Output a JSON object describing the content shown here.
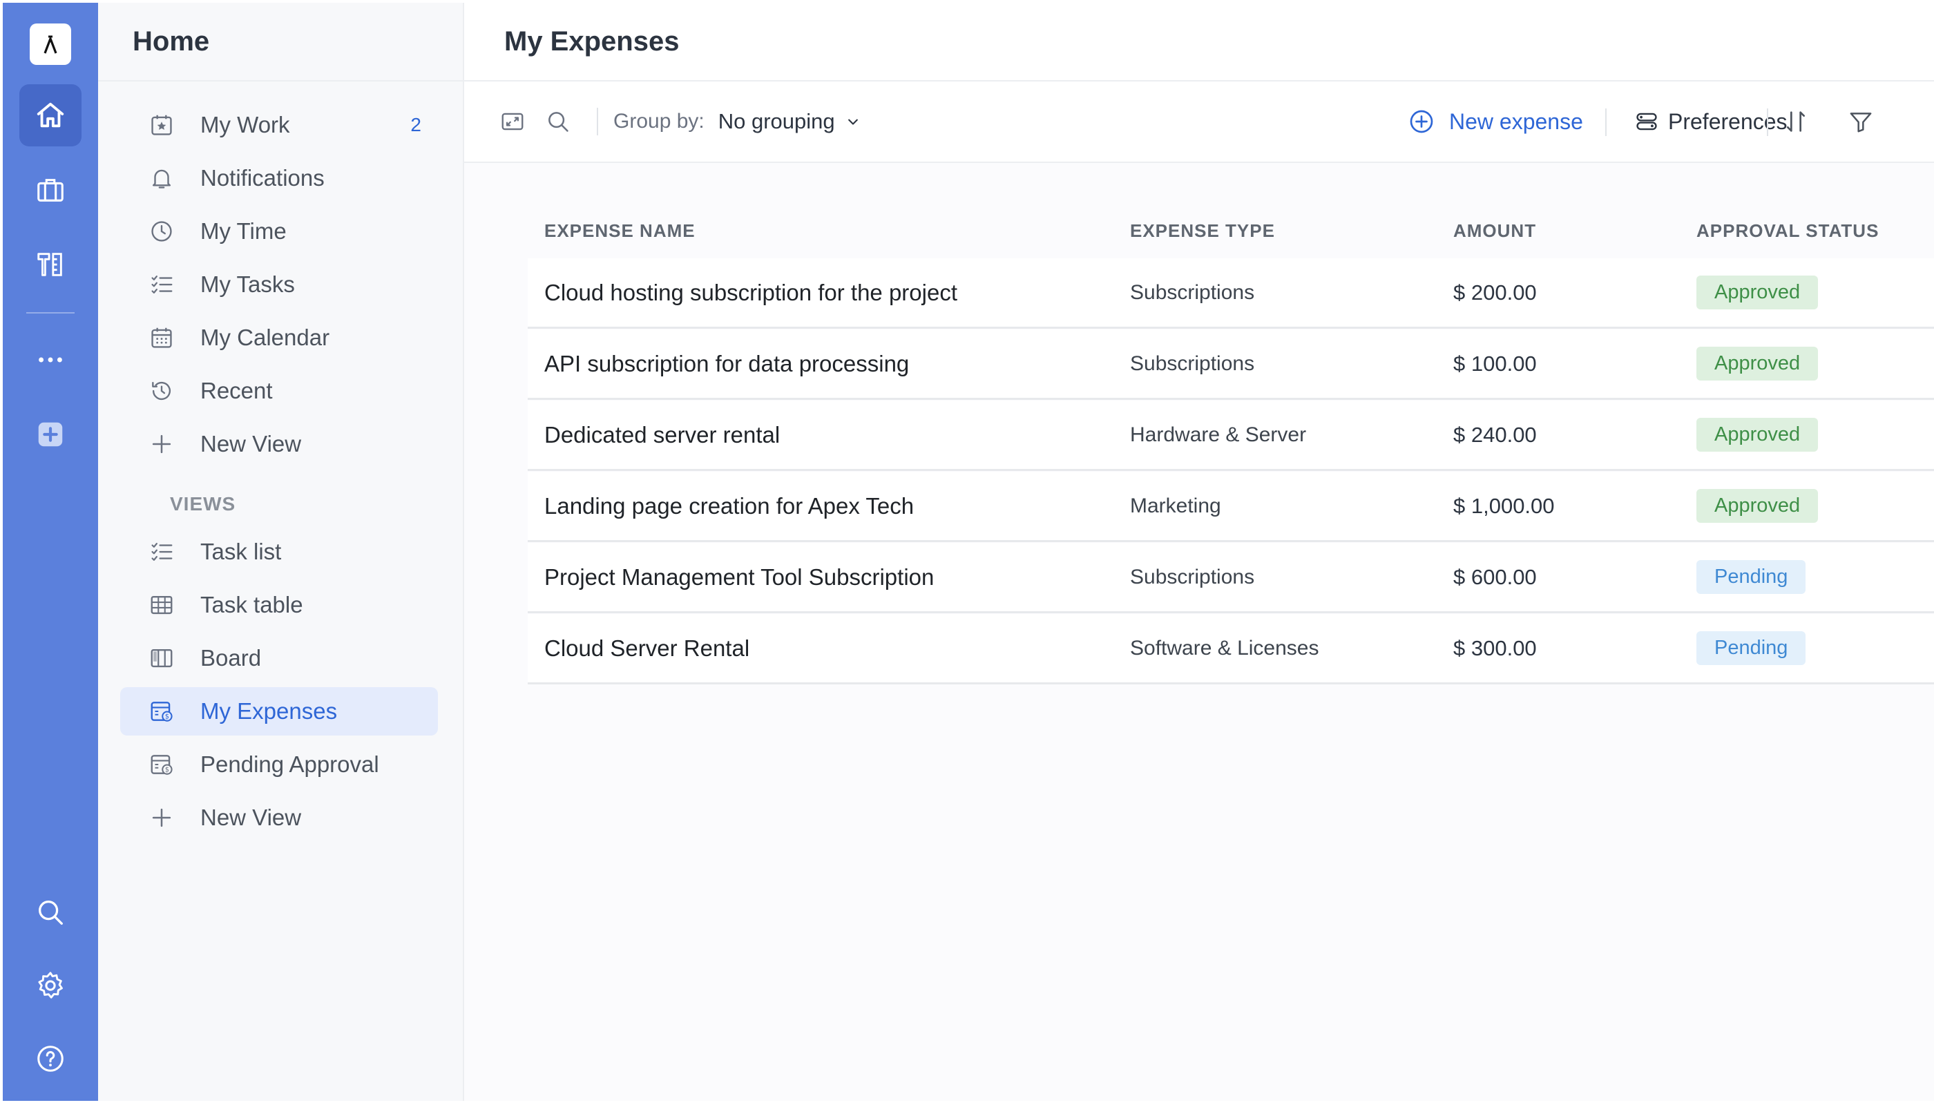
{
  "rail": {
    "items": [
      "home",
      "briefcase",
      "tools",
      "more",
      "add"
    ],
    "bottom": [
      "search",
      "settings",
      "help"
    ]
  },
  "sidebar": {
    "title": "Home",
    "items": [
      {
        "label": "My Work",
        "count": "2",
        "icon": "star-icon"
      },
      {
        "label": "Notifications",
        "icon": "bell-icon"
      },
      {
        "label": "My Time",
        "icon": "clock-icon"
      },
      {
        "label": "My Tasks",
        "icon": "checklist-icon"
      },
      {
        "label": "My Calendar",
        "icon": "calendar-icon"
      },
      {
        "label": "Recent",
        "icon": "history-icon"
      },
      {
        "label": "New View",
        "icon": "plus-icon"
      }
    ],
    "views_label": "VIEWS",
    "views": [
      {
        "label": "Task list",
        "icon": "checklist-icon"
      },
      {
        "label": "Task table",
        "icon": "table-icon"
      },
      {
        "label": "Board",
        "icon": "board-icon"
      },
      {
        "label": "My Expenses",
        "icon": "expense-icon",
        "active": true
      },
      {
        "label": "Pending Approval",
        "icon": "expense-icon"
      },
      {
        "label": "New View",
        "icon": "plus-icon"
      }
    ]
  },
  "main": {
    "title": "My Expenses",
    "toolbar": {
      "groupby_label": "Group by:",
      "groupby_value": "No grouping",
      "new_expense": "New expense",
      "preferences": "Preferences"
    },
    "table": {
      "headers": [
        "EXPENSE NAME",
        "EXPENSE TYPE",
        "AMOUNT",
        "APPROVAL STATUS"
      ],
      "rows": [
        {
          "name": "Cloud hosting subscription for the project",
          "type": "Subscriptions",
          "amount": "$ 200.00",
          "status": "Approved"
        },
        {
          "name": "API subscription for data processing",
          "type": "Subscriptions",
          "amount": "$ 100.00",
          "status": "Approved"
        },
        {
          "name": "Dedicated server rental",
          "type": "Hardware & Server",
          "amount": "$ 240.00",
          "status": "Approved"
        },
        {
          "name": "Landing page creation for Apex Tech",
          "type": "Marketing",
          "amount": "$ 1,000.00",
          "status": "Approved"
        },
        {
          "name": "Project Management Tool Subscription",
          "type": "Subscriptions",
          "amount": "$ 600.00",
          "status": "Pending"
        },
        {
          "name": "Cloud Server Rental",
          "type": "Software & Licenses",
          "amount": "$ 300.00",
          "status": "Pending"
        }
      ]
    }
  },
  "colors": {
    "rail": "#5b80dc",
    "accent": "#2e66d6",
    "approved_bg": "#def0df",
    "approved_text": "#3e8f47",
    "pending_bg": "#e3f0fb",
    "pending_text": "#3f89d3"
  }
}
